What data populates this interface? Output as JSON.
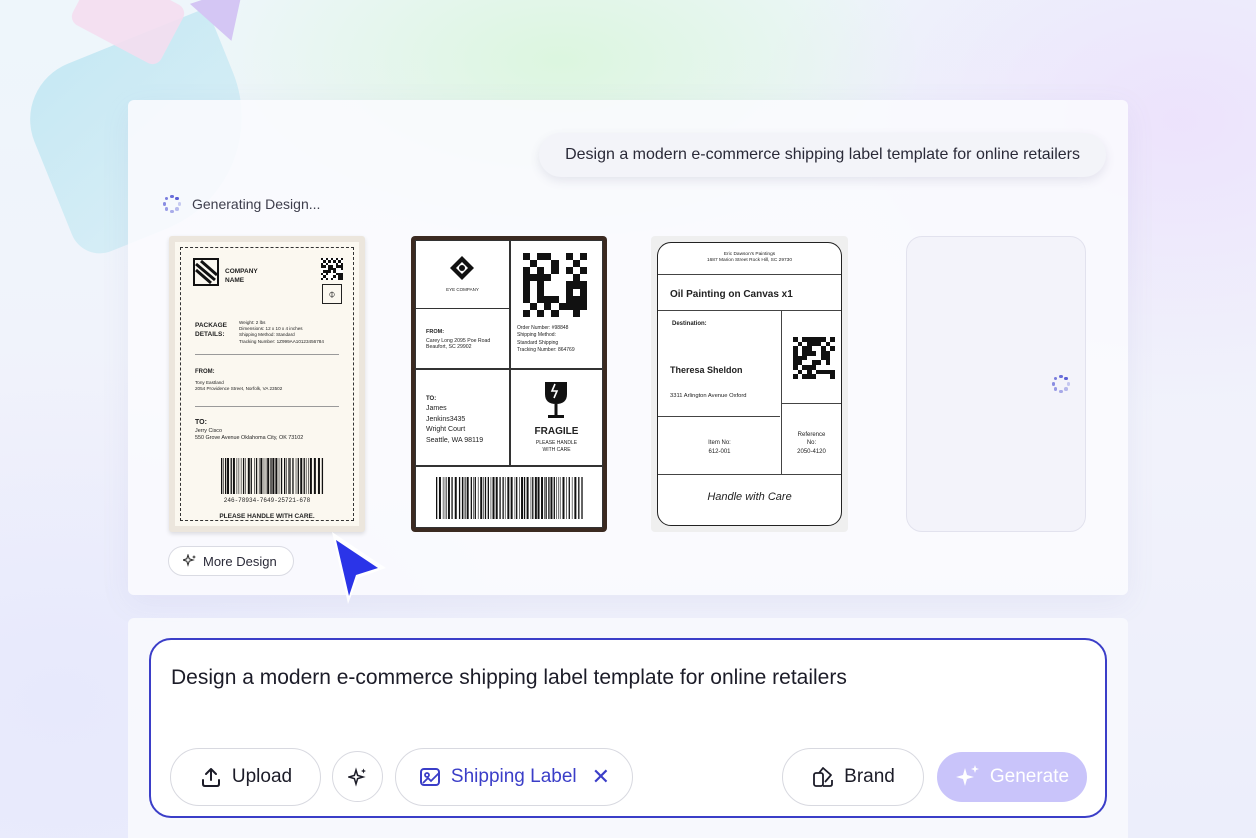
{
  "header": {
    "prompt_chip": "Design a modern e-commerce shipping label template for online retailers",
    "status": "Generating Design..."
  },
  "label1": {
    "company": "COMPANY NAME",
    "package_heading": "PACKAGE DETAILS:",
    "weight": "Weight: 2 lbs",
    "dimensions": "Dimensions: 12 x 10 x 4 inches",
    "shipping_method": "Shipping Method: Standard",
    "tracking": "Tracking Number: 1Z999AA10123456784",
    "from_heading": "FROM:",
    "from_name": "Tony Eastland",
    "from_address": "2054 Providence Street, Norfolk, VA 23502",
    "to_heading": "TO:",
    "to_name": "Jerry Cisco",
    "to_address": "550 Grove Avenue Oklahoma City, OK 73102",
    "barcode_number": "246-78934-7649-25721-678",
    "handle": "PLEASE HANDLE WITH CARE."
  },
  "label2": {
    "company": "EYE COMPANY",
    "from_heading": "FROM:",
    "from_address_1": "Carey Long 2095 Poe Road",
    "from_address_2": "Beaufort, SC 29902",
    "order_number": "Order Number: #98848",
    "shipping_method_label": "Shipping Method:",
    "shipping_method": "Standard Shipping",
    "tracking": "Tracking Number: 864769",
    "to_heading": "TO:",
    "to_line_1": "James",
    "to_line_2": "Jenkins3435",
    "to_line_3": "Wright Court",
    "to_line_4": "Seattle, WA 98119",
    "fragile": "FRAGILE",
    "fragile_sub_1": "PLEASE HANDLE",
    "fragile_sub_2": "WITH CARE"
  },
  "label3": {
    "sender_1": "Eric Dawson's Paintings",
    "sender_2": "1687 Marion Street Rock Hill, SC 29730",
    "item_title": "Oil Painting on Canvas x1",
    "destination_heading": "Destination:",
    "recipient": "Theresa Sheldon",
    "address": "3311 Arlington Avenue Oxford",
    "item_no_label": "Item No:",
    "item_no": "612-001",
    "reference_label_1": "Reference",
    "reference_label_2": "No:",
    "reference_no": "2050-4120",
    "handle": "Handle with Care"
  },
  "buttons": {
    "more_design": "More Design",
    "upload": "Upload",
    "shipping_label": "Shipping Label",
    "brand": "Brand",
    "generate": "Generate"
  },
  "input": {
    "value": "Design a modern e-commerce shipping label template for online retailers"
  },
  "colors": {
    "accent": "#3b3ec8",
    "generate_disabled": "#c9c4fa",
    "label2_frame": "#3b2a21"
  }
}
